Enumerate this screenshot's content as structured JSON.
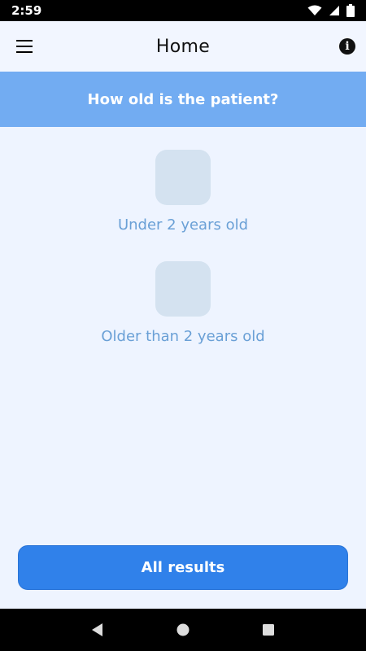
{
  "status_bar": {
    "time": "2:59",
    "icons": [
      "wifi-icon",
      "signal-icon",
      "battery-icon"
    ]
  },
  "app_bar": {
    "title": "Home",
    "left_icon": "menu-icon",
    "right_icon": "info-icon",
    "info_glyph": "i"
  },
  "question": {
    "text": "How old is the patient?"
  },
  "options": [
    {
      "label": "Under 2 years old"
    },
    {
      "label": "Older than 2 years old"
    }
  ],
  "all_results": {
    "label": "All results"
  },
  "nav_bar": {
    "icons": [
      "back-icon",
      "home-icon",
      "recents-icon"
    ]
  },
  "colors": {
    "background": "#eef4ff",
    "banner": "#72acf2",
    "option_tile": "#d4e2f0",
    "option_label": "#6aa0d6",
    "primary_button": "#3081ea"
  }
}
